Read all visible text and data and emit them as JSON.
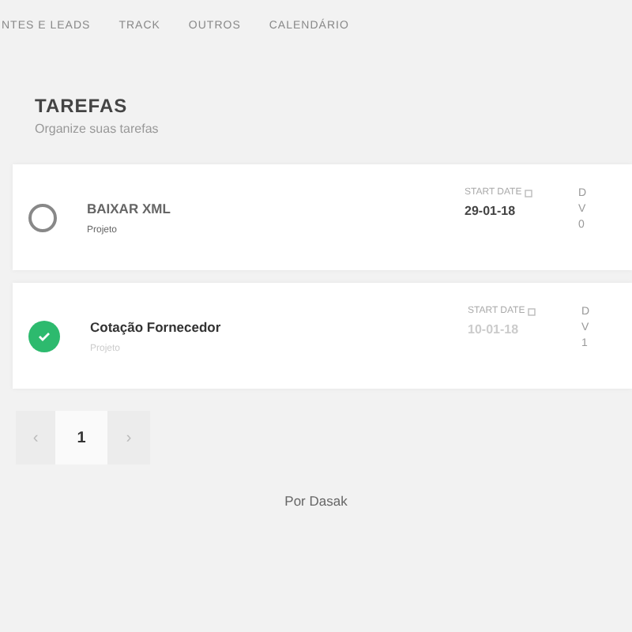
{
  "nav": [
    {
      "label": "NTES E LEADS"
    },
    {
      "label": "TRACK"
    },
    {
      "label": "OUTROS"
    },
    {
      "label": "CALENDÁRIO"
    }
  ],
  "header": {
    "title": "TAREFAS",
    "subtitle": "Organize suas tarefas"
  },
  "tasks": [
    {
      "title": "BAIXAR XML",
      "project": "Projeto",
      "done": false,
      "start_label": "START DATE",
      "start_date": "29-01-18",
      "column_2": [
        "D",
        "V",
        "0"
      ]
    },
    {
      "title": "Cotação Fornecedor",
      "project": "Projeto",
      "done": true,
      "start_label": "START DATE",
      "start_date": "10-01-18",
      "column_2": [
        "D",
        "V",
        "1"
      ]
    }
  ],
  "pagination": {
    "prev": "‹",
    "pages": [
      {
        "label": "1",
        "selected": true
      }
    ],
    "next": "›"
  },
  "footer": "Por Dasak"
}
